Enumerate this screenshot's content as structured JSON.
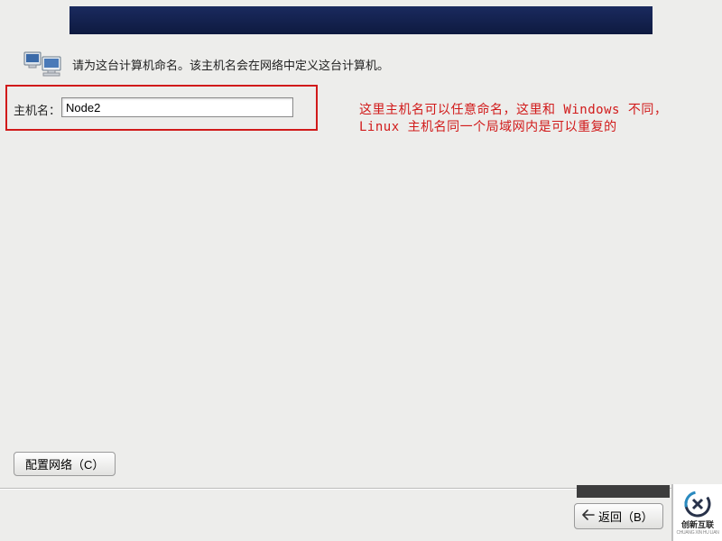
{
  "header": {
    "band_color": "#0e1a40"
  },
  "instruction": {
    "icon": "computer-network-icon",
    "text": "请为这台计算机命名。该主机名会在网络中定义这台计算机。"
  },
  "hostname": {
    "label": "主机名：",
    "value": "Node2"
  },
  "annotation": {
    "text": "这里主机名可以任意命名，这里和 Windows 不同，Linux 主机名同一个局域网内是可以重复的"
  },
  "buttons": {
    "config_network": "配置网络（C）",
    "back": "返回（B）"
  },
  "logo": {
    "brand": "创新互联",
    "sub": "CHUANG XIN HU LIAN"
  },
  "colors": {
    "highlight": "#d11a1a",
    "annotation": "#d11a1a"
  }
}
